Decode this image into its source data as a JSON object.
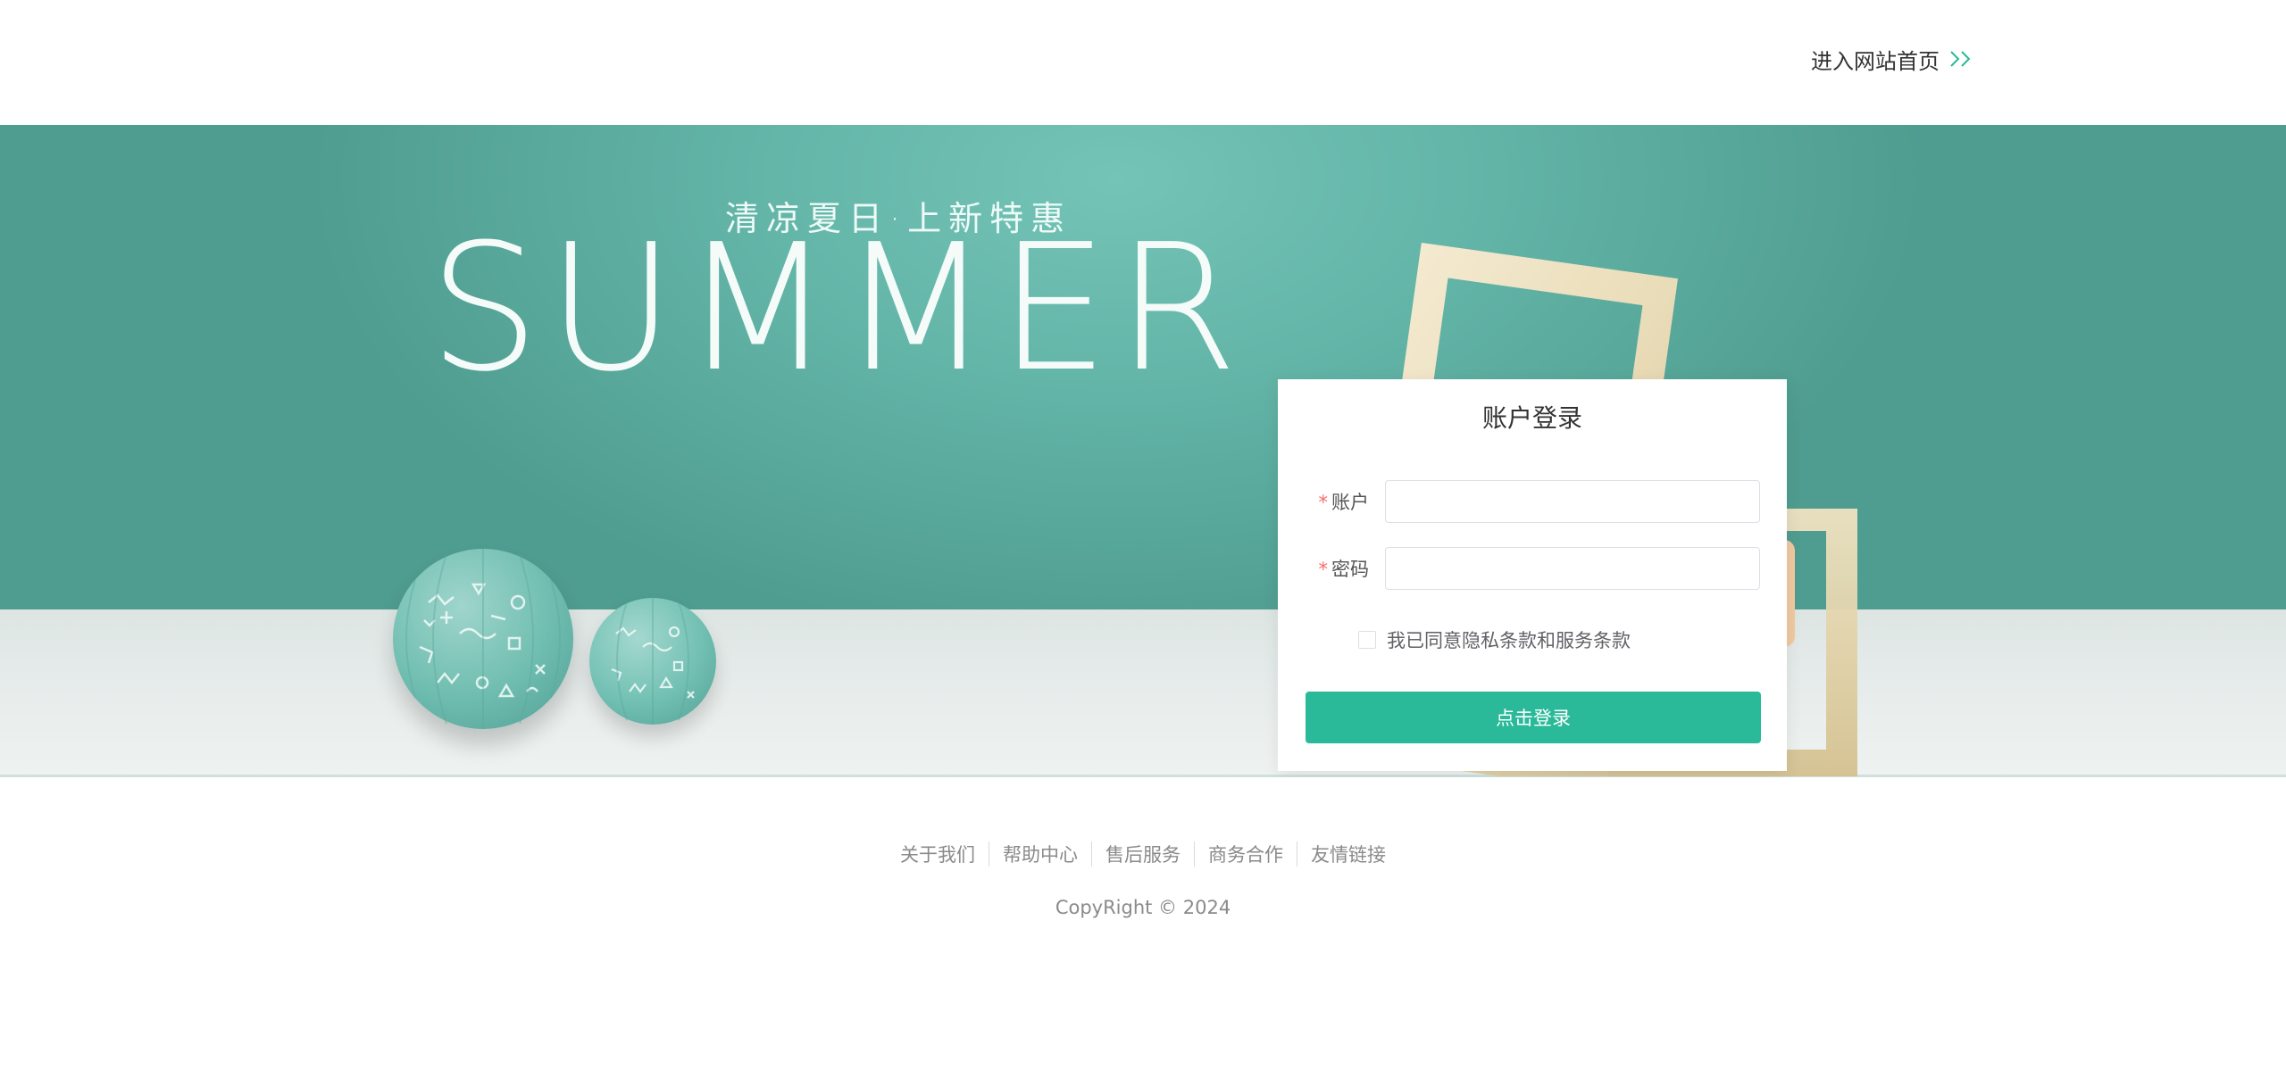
{
  "header": {
    "home_link_label": "进入网站首页",
    "arrow_icon": "double-chevron-right-icon",
    "accent_color": "#2ab999"
  },
  "banner": {
    "slogan_cn": "清凉夏日·上新特惠",
    "slogan_en": "SUMMER",
    "background_color": "#63b5a8"
  },
  "login": {
    "title": "账户登录",
    "account_label": "账户",
    "password_label": "密码",
    "required_mark": "*",
    "account_value": "",
    "password_value": "",
    "agree_label": "我已同意隐私条款和服务条款",
    "agree_checked": false,
    "submit_label": "点击登录",
    "button_color": "#2ab999"
  },
  "footer": {
    "links": [
      "关于我们",
      "帮助中心",
      "售后服务",
      "商务合作",
      "友情链接"
    ],
    "copyright": "CopyRight © 2024"
  }
}
